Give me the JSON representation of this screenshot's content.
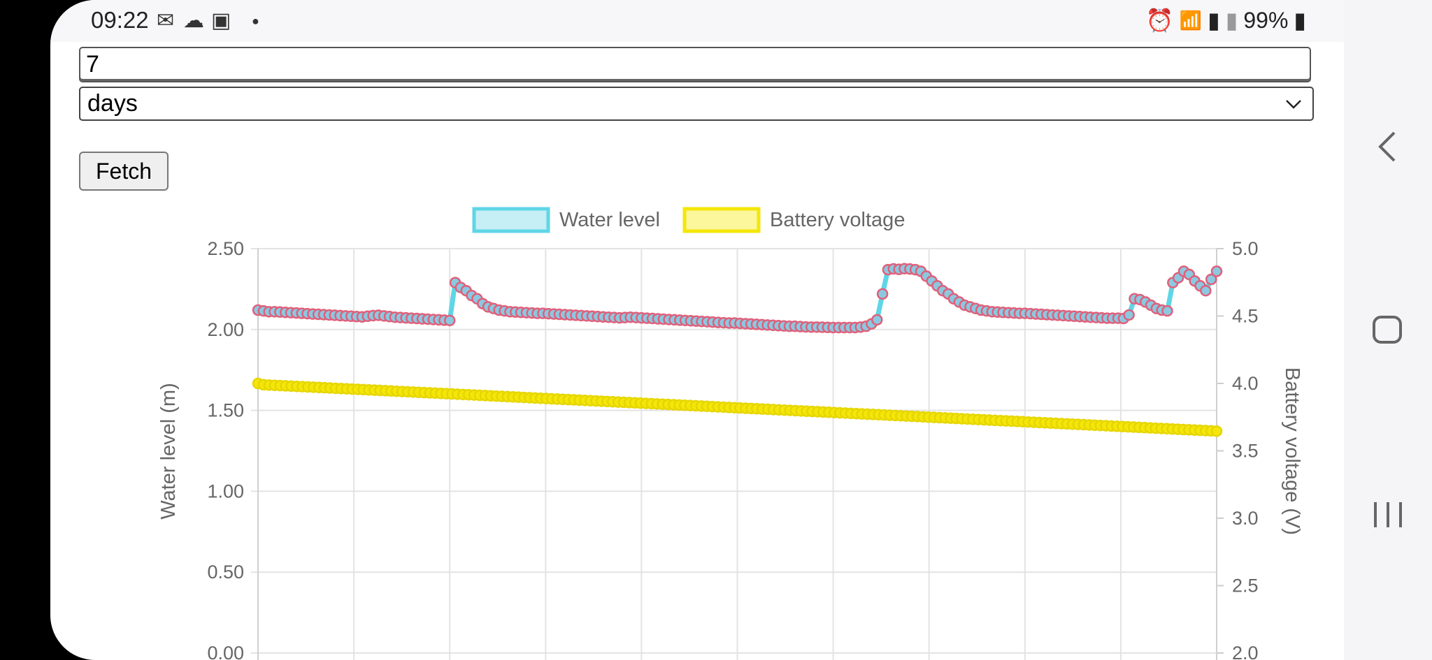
{
  "status_bar": {
    "time": "09:22",
    "left_icons": [
      "mail-icon",
      "cloud-icon",
      "notification-icon",
      "dot-icon"
    ],
    "right_icons": [
      "alarm-icon",
      "wifi-icon",
      "signal-icon",
      "signal-weak-icon",
      "battery-icon"
    ],
    "battery": "99%"
  },
  "form": {
    "amount_value": "7",
    "unit_selected": "days",
    "fetch_label": "Fetch"
  },
  "nav": {
    "back": "back-icon",
    "home": "home-icon",
    "recents": "recents-icon"
  },
  "chart_data": {
    "type": "line",
    "legend_position": "top",
    "grid": true,
    "series": [
      {
        "name": "Water level",
        "axis": "left",
        "line_color": "#5fd6e6",
        "point_fill": "#8cc8e0",
        "point_border": "#e0607a",
        "values": [
          2.12,
          2.115,
          2.11,
          2.11,
          2.108,
          2.106,
          2.104,
          2.102,
          2.1,
          2.098,
          2.096,
          2.094,
          2.092,
          2.09,
          2.088,
          2.086,
          2.084,
          2.082,
          2.08,
          2.078,
          2.082,
          2.086,
          2.088,
          2.084,
          2.08,
          2.076,
          2.074,
          2.072,
          2.07,
          2.068,
          2.066,
          2.064,
          2.062,
          2.06,
          2.058,
          2.056,
          2.29,
          2.26,
          2.24,
          2.21,
          2.19,
          2.16,
          2.14,
          2.13,
          2.12,
          2.115,
          2.11,
          2.108,
          2.106,
          2.104,
          2.102,
          2.1,
          2.1,
          2.098,
          2.096,
          2.094,
          2.092,
          2.09,
          2.088,
          2.086,
          2.084,
          2.082,
          2.08,
          2.078,
          2.076,
          2.074,
          2.072,
          2.074,
          2.076,
          2.074,
          2.072,
          2.07,
          2.068,
          2.066,
          2.064,
          2.062,
          2.06,
          2.058,
          2.056,
          2.054,
          2.052,
          2.05,
          2.048,
          2.046,
          2.044,
          2.042,
          2.04,
          2.04,
          2.038,
          2.036,
          2.034,
          2.032,
          2.03,
          2.028,
          2.026,
          2.024,
          2.022,
          2.02,
          2.02,
          2.018,
          2.016,
          2.015,
          2.015,
          2.014,
          2.013,
          2.012,
          2.012,
          2.012,
          2.012,
          2.012,
          2.015,
          2.02,
          2.035,
          2.06,
          2.22,
          2.37,
          2.375,
          2.372,
          2.376,
          2.374,
          2.37,
          2.36,
          2.33,
          2.3,
          2.27,
          2.24,
          2.22,
          2.19,
          2.17,
          2.15,
          2.14,
          2.13,
          2.12,
          2.115,
          2.11,
          2.108,
          2.106,
          2.104,
          2.102,
          2.1,
          2.1,
          2.098,
          2.096,
          2.094,
          2.092,
          2.09,
          2.088,
          2.086,
          2.084,
          2.082,
          2.08,
          2.078,
          2.076,
          2.074,
          2.072,
          2.07,
          2.07,
          2.07,
          2.068,
          2.09,
          2.19,
          2.185,
          2.17,
          2.15,
          2.13,
          2.12,
          2.115,
          2.29,
          2.32,
          2.36,
          2.34,
          2.3,
          2.27,
          2.24,
          2.31,
          2.36
        ]
      },
      {
        "name": "Battery voltage",
        "axis": "right",
        "line_color": "#f4e60a",
        "point_fill": "#f4e60a",
        "point_border": "#e6d600",
        "values": [
          4.0,
          3.99,
          3.988,
          3.986,
          3.984,
          3.982,
          3.98,
          3.978,
          3.976,
          3.974,
          3.972,
          3.97,
          3.968,
          3.966,
          3.964,
          3.962,
          3.96,
          3.958,
          3.956,
          3.954,
          3.952,
          3.95,
          3.948,
          3.946,
          3.944,
          3.942,
          3.94,
          3.938,
          3.936,
          3.934,
          3.932,
          3.93,
          3.928,
          3.926,
          3.924,
          3.922,
          3.92,
          3.918,
          3.916,
          3.914,
          3.912,
          3.91,
          3.908,
          3.906,
          3.904,
          3.902,
          3.9,
          3.898,
          3.896,
          3.894,
          3.892,
          3.89,
          3.888,
          3.886,
          3.884,
          3.882,
          3.88,
          3.878,
          3.876,
          3.874,
          3.872,
          3.87,
          3.868,
          3.866,
          3.864,
          3.862,
          3.86,
          3.858,
          3.856,
          3.854,
          3.852,
          3.85,
          3.848,
          3.846,
          3.844,
          3.842,
          3.84,
          3.838,
          3.836,
          3.834,
          3.832,
          3.83,
          3.828,
          3.826,
          3.824,
          3.822,
          3.82,
          3.818,
          3.816,
          3.814,
          3.812,
          3.81,
          3.808,
          3.806,
          3.804,
          3.802,
          3.8,
          3.798,
          3.796,
          3.794,
          3.792,
          3.79,
          3.788,
          3.786,
          3.784,
          3.782,
          3.78,
          3.778,
          3.776,
          3.774,
          3.772,
          3.77,
          3.768,
          3.766,
          3.764,
          3.762,
          3.76,
          3.758,
          3.756,
          3.754,
          3.752,
          3.75,
          3.748,
          3.746,
          3.744,
          3.742,
          3.74,
          3.738,
          3.736,
          3.734,
          3.732,
          3.73,
          3.728,
          3.726,
          3.724,
          3.722,
          3.72,
          3.718,
          3.716,
          3.714,
          3.712,
          3.71,
          3.708,
          3.706,
          3.704,
          3.702,
          3.7,
          3.698,
          3.696,
          3.694,
          3.692,
          3.69,
          3.688,
          3.686,
          3.684,
          3.682,
          3.68,
          3.678,
          3.676,
          3.674,
          3.672,
          3.67,
          3.668,
          3.666,
          3.664,
          3.662,
          3.66,
          3.658,
          3.656,
          3.654,
          3.652,
          3.65,
          3.648,
          3.646
        ]
      }
    ],
    "y_left": {
      "label": "Water level (m)",
      "min": 0,
      "max": 2.5,
      "ticks": [
        "2.50",
        "2.00",
        "1.50",
        "1.00",
        "0.50",
        "0.00"
      ]
    },
    "y_right": {
      "label": "Battery voltage (V)",
      "min": 2.0,
      "max": 5.0,
      "ticks": [
        "5.0",
        "4.5",
        "4.0",
        "3.5",
        "3.0",
        "2.5",
        "2.0"
      ]
    },
    "x_gridlines": 11
  }
}
